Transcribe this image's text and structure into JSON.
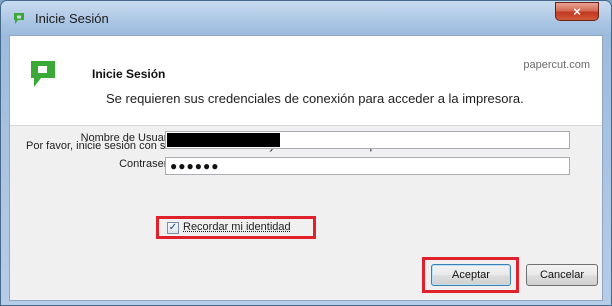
{
  "window": {
    "title": "Inicie Sesión",
    "close_glyph": "×"
  },
  "header": {
    "title": "Inicie Sesión",
    "brand": "papercut.com",
    "subtitle": "Se requieren sus credenciales de conexión para acceder a la impresora.",
    "logo_icon": "papercut-logo-icon",
    "logo_color": "#3aa935"
  },
  "form": {
    "instructions": "Por favor, inicie sesión con su nombre de usuario y contraseña de red para confirmar su identidad.",
    "username_label": "Nombre de Usuario:",
    "username_value_redacted": true,
    "password_label": "Contraseña:",
    "password_value": "●●●●●●",
    "remember_label": "Recordar mi identidad",
    "remember_checked": true,
    "check_glyph": "✓"
  },
  "buttons": {
    "accept": "Aceptar",
    "cancel": "Cancelar"
  },
  "highlight_color": "#e0202a"
}
